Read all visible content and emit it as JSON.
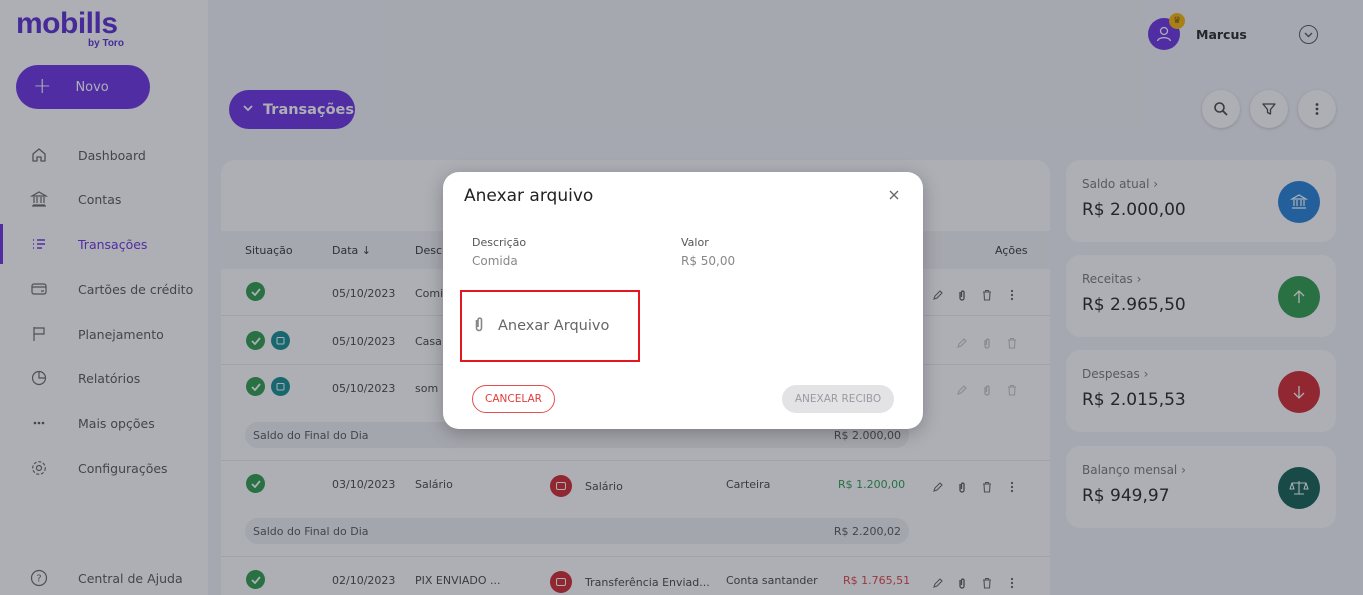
{
  "brand": {
    "logo": "mobills",
    "sub": "by Toro",
    "accent": "#6a2ee0"
  },
  "sidebar": {
    "new_label": "Novo",
    "items": [
      {
        "label": "Dashboard",
        "icon": "home-icon"
      },
      {
        "label": "Contas",
        "icon": "bank-icon"
      },
      {
        "label": "Transações",
        "icon": "list-icon",
        "active": true
      },
      {
        "label": "Cartões de crédito",
        "icon": "credit-card-icon"
      },
      {
        "label": "Planejamento",
        "icon": "flag-icon"
      },
      {
        "label": "Relatórios",
        "icon": "pie-chart-icon"
      },
      {
        "label": "Mais opções",
        "icon": "more-horizontal-icon"
      },
      {
        "label": "Configurações",
        "icon": "gear-icon"
      }
    ],
    "help_label": "Central de Ajuda"
  },
  "header": {
    "user_name": "Marcus",
    "page_selector": "Transações"
  },
  "table": {
    "headers": {
      "status": "Situação",
      "date": "Data",
      "description": "Descr",
      "actions": "Ações"
    },
    "rows": [
      {
        "date": "05/10/2023",
        "description": "Comi",
        "calendar": false
      },
      {
        "date": "05/10/2023",
        "description": "Casa",
        "calendar": true
      },
      {
        "date": "05/10/2023",
        "description": "som",
        "calendar": true
      },
      {
        "date": "03/10/2023",
        "description": "Salário",
        "category": "Salário",
        "account": "Carteira",
        "value": "R$ 1.200,00",
        "value_color": "#2b9a48"
      },
      {
        "date": "02/10/2023",
        "description": "PIX ENVIADO ...",
        "category": "Transferência Enviad...",
        "account": "Conta santander",
        "value": "R$ 1.765,51",
        "value_color": "#e23c3c"
      }
    ],
    "day_balances": [
      {
        "label": "Saldo do Final do Dia",
        "value": "R$ 2.000,00"
      },
      {
        "label": "Saldo do Final do Dia",
        "value": "R$ 2.200,02"
      }
    ]
  },
  "summary": [
    {
      "label": "Saldo atual",
      "value": "R$ 2.000,00",
      "color": "#1f7fd6",
      "icon": "bank-icon"
    },
    {
      "label": "Receitas",
      "value": "R$ 2.965,50",
      "color": "#2b9a48",
      "icon": "arrow-up-icon"
    },
    {
      "label": "Despesas",
      "value": "R$ 2.015,53",
      "color": "#d0242a",
      "icon": "arrow-down-icon"
    },
    {
      "label": "Balanço mensal",
      "value": "R$ 949,97",
      "color": "#0f5e4f",
      "icon": "scale-icon"
    }
  ],
  "modal": {
    "title": "Anexar arquivo",
    "description_label": "Descrição",
    "description_value": "Comida",
    "value_label": "Valor",
    "value_value": "R$ 50,00",
    "attach_label": "Anexar Arquivo",
    "cancel_label": "CANCELAR",
    "submit_label": "ANEXAR RECIBO"
  }
}
